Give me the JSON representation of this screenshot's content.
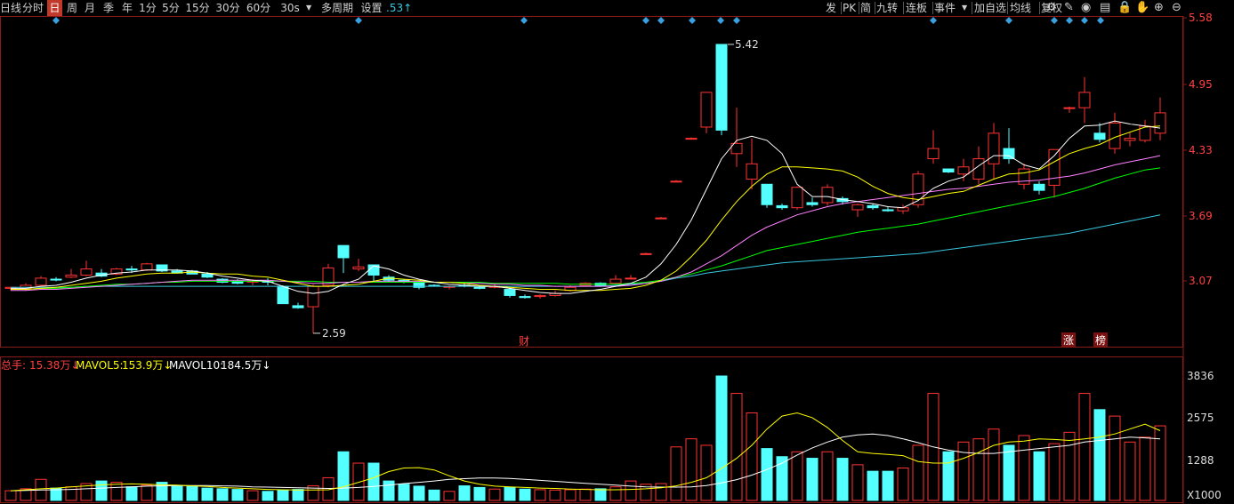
{
  "toolbar": {
    "left": [
      {
        "label": "日线",
        "name": "tab-day-line"
      },
      {
        "label": "分时",
        "name": "tab-timeshare"
      },
      {
        "label": "日",
        "name": "tab-day",
        "active": true
      },
      {
        "label": "周",
        "name": "tab-week"
      },
      {
        "label": "月",
        "name": "tab-month"
      },
      {
        "label": "季",
        "name": "tab-quarter"
      },
      {
        "label": "年",
        "name": "tab-year"
      },
      {
        "label": "1分",
        "name": "tab-1min"
      },
      {
        "label": "5分",
        "name": "tab-5min"
      },
      {
        "label": "15分",
        "name": "tab-15min"
      },
      {
        "label": "30分",
        "name": "tab-30min"
      },
      {
        "label": "60分",
        "name": "tab-60min"
      },
      {
        "label": "30s",
        "name": "tab-30s"
      },
      {
        "label": "多周期",
        "name": "multi-period-button"
      },
      {
        "label": "设置",
        "name": "settings-button"
      },
      {
        "label": ".53↑",
        "name": "price-indicator"
      }
    ],
    "right": [
      {
        "label": "发",
        "name": "publish-button"
      },
      {
        "label": "PK",
        "name": "pk-button"
      },
      {
        "label": "简",
        "name": "simple-button"
      },
      {
        "label": "九转",
        "name": "nine-turn-button"
      },
      {
        "label": "连板",
        "name": "continuous-limit-button"
      },
      {
        "label": "事件",
        "name": "event-button"
      },
      {
        "label": "加自选",
        "name": "add-watchlist-button"
      },
      {
        "label": "均线",
        "name": "moving-average-button"
      },
      {
        "label": "复权",
        "name": "adjust-button"
      }
    ],
    "icons": [
      "settings-icon",
      "draw-icon",
      "eye-icon",
      "save-icon",
      "lock-icon",
      "hand-icon",
      "zoom-in-icon",
      "zoom-out-icon"
    ]
  },
  "price_axis": [
    "5.58",
    "4.95",
    "4.33",
    "3.69",
    "3.07"
  ],
  "volume_axis": [
    "3836",
    "2575",
    "1288",
    "X1000"
  ],
  "annotations": {
    "high": "5.42",
    "low": "2.59",
    "tag_finance": "财",
    "tag_rise": "涨",
    "tag_rank": "榜"
  },
  "volume_legend": {
    "label_total": "总手:",
    "total": "15.38万↓",
    "label_ma5": "MAVOL5:",
    "ma5": "153.9万↓",
    "label_ma10": "MAVOL10:",
    "ma10": "184.5万↓"
  },
  "colors": {
    "up": "#ff3232",
    "down": "#54ffff",
    "ma5": "#ffffff",
    "ma10": "#ffff00",
    "ma20": "#ff80ff",
    "ma30": "#00ff00",
    "ma60": "#38c8e0",
    "accent": "#c0392b"
  },
  "chart_data": {
    "type": "candlestick",
    "ylim": [
      2.45,
      5.62
    ],
    "vol_ylim": [
      0,
      3836
    ],
    "candles": [
      [
        3.03,
        3.04,
        3.01,
        3.04,
        300,
        "u"
      ],
      [
        3.03,
        3.08,
        3.01,
        3.06,
        360,
        "u"
      ],
      [
        3.06,
        3.15,
        3.05,
        3.13,
        650,
        "u"
      ],
      [
        3.12,
        3.14,
        3.1,
        3.12,
        380,
        "d"
      ],
      [
        3.14,
        3.22,
        3.13,
        3.16,
        420,
        "u"
      ],
      [
        3.16,
        3.3,
        3.15,
        3.22,
        520,
        "u"
      ],
      [
        3.18,
        3.22,
        3.14,
        3.15,
        600,
        "d"
      ],
      [
        3.17,
        3.23,
        3.16,
        3.22,
        560,
        "u"
      ],
      [
        3.22,
        3.25,
        3.18,
        3.21,
        420,
        "d"
      ],
      [
        3.21,
        3.28,
        3.2,
        3.27,
        470,
        "u"
      ],
      [
        3.26,
        3.26,
        3.19,
        3.2,
        560,
        "d"
      ],
      [
        3.2,
        3.22,
        3.18,
        3.18,
        450,
        "d"
      ],
      [
        3.2,
        3.21,
        3.17,
        3.17,
        430,
        "d"
      ],
      [
        3.17,
        3.19,
        3.13,
        3.14,
        380,
        "d"
      ],
      [
        3.12,
        3.13,
        3.08,
        3.09,
        360,
        "d"
      ],
      [
        3.1,
        3.12,
        3.07,
        3.08,
        340,
        "d"
      ],
      [
        3.1,
        3.12,
        3.06,
        3.1,
        300,
        "u"
      ],
      [
        3.1,
        3.13,
        3.06,
        3.09,
        280,
        "d"
      ],
      [
        3.05,
        3.06,
        2.88,
        2.88,
        320,
        "d"
      ],
      [
        2.86,
        2.89,
        2.83,
        2.84,
        340,
        "d"
      ],
      [
        2.85,
        3.07,
        2.59,
        3.05,
        450,
        "u"
      ],
      [
        3.06,
        3.27,
        3.04,
        3.23,
        700,
        "u"
      ],
      [
        3.45,
        3.45,
        3.18,
        3.33,
        1500,
        "d"
      ],
      [
        3.22,
        3.32,
        3.2,
        3.24,
        1150,
        "u"
      ],
      [
        3.26,
        3.26,
        3.09,
        3.16,
        1150,
        "d"
      ],
      [
        3.14,
        3.16,
        3.09,
        3.11,
        600,
        "d"
      ],
      [
        3.11,
        3.12,
        3.08,
        3.09,
        500,
        "d"
      ],
      [
        3.09,
        3.1,
        3.02,
        3.04,
        440,
        "d"
      ],
      [
        3.06,
        3.07,
        3.05,
        3.06,
        320,
        "d"
      ],
      [
        3.05,
        3.06,
        3.02,
        3.04,
        280,
        "u"
      ],
      [
        3.06,
        3.08,
        3.04,
        3.06,
        450,
        "d"
      ],
      [
        3.03,
        3.05,
        3.02,
        3.04,
        400,
        "d"
      ],
      [
        3.04,
        3.08,
        3.03,
        3.05,
        350,
        "u"
      ],
      [
        3.02,
        3.04,
        2.94,
        2.96,
        410,
        "d"
      ],
      [
        2.95,
        2.97,
        2.93,
        2.94,
        350,
        "d"
      ],
      [
        2.95,
        2.97,
        2.93,
        2.96,
        330,
        "u"
      ],
      [
        2.96,
        3.01,
        2.95,
        2.98,
        320,
        "u"
      ],
      [
        3.01,
        3.06,
        3.0,
        3.04,
        330,
        "u"
      ],
      [
        3.06,
        3.09,
        3.05,
        3.08,
        350,
        "u"
      ],
      [
        3.08,
        3.09,
        3.05,
        3.06,
        360,
        "d"
      ],
      [
        3.08,
        3.16,
        3.07,
        3.12,
        420,
        "u"
      ],
      [
        3.13,
        3.16,
        3.12,
        3.13,
        600,
        "u"
      ],
      [
        3.37,
        3.38,
        3.36,
        3.37,
        500,
        "u"
      ],
      [
        3.72,
        3.73,
        3.71,
        3.72,
        520,
        "u"
      ],
      [
        4.08,
        4.09,
        4.07,
        4.08,
        1650,
        "u"
      ],
      [
        4.5,
        4.51,
        4.49,
        4.5,
        1900,
        "u"
      ],
      [
        4.61,
        4.95,
        4.55,
        4.95,
        1700,
        "u"
      ],
      [
        5.42,
        5.42,
        4.53,
        4.58,
        3836,
        "d"
      ],
      [
        4.45,
        4.8,
        4.22,
        4.35,
        3300,
        "u"
      ],
      [
        4.25,
        4.5,
        4.0,
        4.1,
        2700,
        "u"
      ],
      [
        4.05,
        4.05,
        3.82,
        3.85,
        1600,
        "d"
      ],
      [
        3.84,
        3.86,
        3.8,
        3.82,
        1350,
        "d"
      ],
      [
        3.82,
        4.03,
        3.8,
        4.02,
        1500,
        "u"
      ],
      [
        3.85,
        3.92,
        3.83,
        3.87,
        1300,
        "d"
      ],
      [
        3.87,
        4.05,
        3.84,
        4.02,
        1500,
        "u"
      ],
      [
        3.91,
        3.93,
        3.85,
        3.88,
        1300,
        "d"
      ],
      [
        3.8,
        3.86,
        3.73,
        3.85,
        1100,
        "u"
      ],
      [
        3.84,
        3.86,
        3.8,
        3.82,
        900,
        "d"
      ],
      [
        3.8,
        3.83,
        3.78,
        3.79,
        900,
        "d"
      ],
      [
        3.79,
        3.85,
        3.76,
        3.82,
        1000,
        "u"
      ],
      [
        3.85,
        4.18,
        3.82,
        4.15,
        1700,
        "u"
      ],
      [
        4.3,
        4.58,
        4.25,
        4.4,
        3300,
        "u"
      ],
      [
        4.2,
        4.2,
        4.16,
        4.17,
        1500,
        "d"
      ],
      [
        4.15,
        4.3,
        4.08,
        4.22,
        1800,
        "u"
      ],
      [
        4.1,
        4.42,
        4.05,
        4.3,
        1900,
        "u"
      ],
      [
        4.25,
        4.65,
        4.1,
        4.55,
        2200,
        "u"
      ],
      [
        4.4,
        4.6,
        4.25,
        4.3,
        1700,
        "d"
      ],
      [
        4.2,
        4.25,
        4.0,
        4.05,
        2000,
        "u"
      ],
      [
        4.05,
        4.08,
        3.95,
        3.99,
        1500,
        "d"
      ],
      [
        4.04,
        4.39,
        3.92,
        4.39,
        1750,
        "u"
      ],
      [
        4.8,
        4.81,
        4.75,
        4.8,
        2100,
        "u"
      ],
      [
        4.8,
        5.1,
        4.65,
        4.95,
        3300,
        "u"
      ],
      [
        4.55,
        4.65,
        4.46,
        4.49,
        2800,
        "d"
      ],
      [
        4.4,
        4.75,
        4.35,
        4.65,
        2600,
        "u"
      ],
      [
        4.48,
        4.56,
        4.42,
        4.5,
        1800,
        "u"
      ],
      [
        4.48,
        4.68,
        4.46,
        4.62,
        1950,
        "u"
      ],
      [
        4.55,
        4.9,
        4.48,
        4.75,
        2300,
        "u"
      ]
    ],
    "ma5": [
      3.03,
      3.03,
      3.05,
      3.06,
      3.09,
      3.13,
      3.16,
      3.18,
      3.19,
      3.21,
      3.21,
      3.21,
      3.2,
      3.18,
      3.15,
      3.13,
      3.11,
      3.1,
      3.05,
      3.0,
      2.98,
      3.0,
      3.07,
      3.12,
      3.25,
      3.22,
      3.16,
      3.12,
      3.09,
      3.07,
      3.06,
      3.05,
      3.05,
      3.03,
      3.01,
      2.99,
      2.98,
      2.98,
      3.0,
      3.02,
      3.05,
      3.08,
      3.14,
      3.27,
      3.46,
      3.7,
      4.0,
      4.3,
      4.48,
      4.52,
      4.48,
      4.35,
      4.05,
      3.93,
      3.93,
      3.9,
      3.88,
      3.86,
      3.83,
      3.82,
      3.89,
      4.01,
      4.08,
      4.12,
      4.23,
      4.33,
      4.33,
      4.24,
      4.2,
      4.33,
      4.5,
      4.62,
      4.63,
      4.67,
      4.64,
      4.62,
      4.6
    ],
    "ma10": [
      3.02,
      3.02,
      3.03,
      3.04,
      3.06,
      3.08,
      3.1,
      3.13,
      3.15,
      3.17,
      3.18,
      3.18,
      3.19,
      3.18,
      3.17,
      3.17,
      3.15,
      3.14,
      3.11,
      3.08,
      3.05,
      3.05,
      3.06,
      3.07,
      3.1,
      3.13,
      3.12,
      3.11,
      3.09,
      3.09,
      3.08,
      3.06,
      3.05,
      3.04,
      3.03,
      3.02,
      3.02,
      3.01,
      3.01,
      3.01,
      3.02,
      3.03,
      3.06,
      3.11,
      3.2,
      3.34,
      3.5,
      3.7,
      3.88,
      4.03,
      4.15,
      4.22,
      4.22,
      4.21,
      4.2,
      4.18,
      4.12,
      4.03,
      3.96,
      3.92,
      3.9,
      3.93,
      3.96,
      3.98,
      4.04,
      4.1,
      4.15,
      4.16,
      4.19,
      4.27,
      4.35,
      4.4,
      4.44,
      4.51,
      4.56,
      4.61,
      4.62
    ],
    "ma20": [
      3.01,
      3.01,
      3.02,
      3.02,
      3.03,
      3.04,
      3.05,
      3.06,
      3.07,
      3.08,
      3.09,
      3.1,
      3.11,
      3.11,
      3.11,
      3.11,
      3.11,
      3.11,
      3.1,
      3.09,
      3.08,
      3.08,
      3.09,
      3.09,
      3.1,
      3.1,
      3.1,
      3.1,
      3.09,
      3.09,
      3.08,
      3.08,
      3.07,
      3.07,
      3.06,
      3.06,
      3.05,
      3.05,
      3.05,
      3.05,
      3.05,
      3.06,
      3.08,
      3.1,
      3.14,
      3.19,
      3.27,
      3.35,
      3.45,
      3.55,
      3.63,
      3.69,
      3.75,
      3.79,
      3.83,
      3.86,
      3.88,
      3.9,
      3.92,
      3.94,
      3.96,
      3.98,
      4.0,
      4.01,
      4.03,
      4.05,
      4.07,
      4.08,
      4.09,
      4.11,
      4.13,
      4.16,
      4.2,
      4.24,
      4.27,
      4.3,
      4.33
    ],
    "ma30": [
      3.02,
      3.02,
      3.03,
      3.03,
      3.04,
      3.05,
      3.06,
      3.07,
      3.07,
      3.08,
      3.09,
      3.09,
      3.1,
      3.1,
      3.1,
      3.1,
      3.1,
      3.1,
      3.1,
      3.1,
      3.1,
      3.09,
      3.09,
      3.09,
      3.09,
      3.09,
      3.09,
      3.09,
      3.09,
      3.09,
      3.09,
      3.09,
      3.08,
      3.08,
      3.08,
      3.08,
      3.08,
      3.07,
      3.07,
      3.07,
      3.07,
      3.08,
      3.09,
      3.11,
      3.14,
      3.17,
      3.21,
      3.25,
      3.3,
      3.35,
      3.4,
      3.43,
      3.46,
      3.49,
      3.52,
      3.55,
      3.58,
      3.6,
      3.62,
      3.64,
      3.66,
      3.69,
      3.72,
      3.75,
      3.78,
      3.81,
      3.84,
      3.87,
      3.9,
      3.93,
      3.97,
      4.01,
      4.06,
      4.11,
      4.15,
      4.19,
      4.21
    ],
    "ma60": [
      3.04,
      3.04,
      3.04,
      3.04,
      3.04,
      3.05,
      3.05,
      3.05,
      3.05,
      3.05,
      3.05,
      3.05,
      3.05,
      3.05,
      3.05,
      3.05,
      3.05,
      3.05,
      3.05,
      3.05,
      3.05,
      3.05,
      3.05,
      3.05,
      3.05,
      3.05,
      3.05,
      3.05,
      3.05,
      3.05,
      3.05,
      3.05,
      3.05,
      3.05,
      3.05,
      3.05,
      3.05,
      3.05,
      3.05,
      3.05,
      3.06,
      3.07,
      3.08,
      3.1,
      3.13,
      3.15,
      3.18,
      3.2,
      3.22,
      3.24,
      3.26,
      3.28,
      3.29,
      3.3,
      3.31,
      3.32,
      3.33,
      3.34,
      3.35,
      3.36,
      3.37,
      3.39,
      3.41,
      3.43,
      3.45,
      3.47,
      3.49,
      3.51,
      3.53,
      3.55,
      3.57,
      3.6,
      3.63,
      3.66,
      3.69,
      3.72,
      3.75
    ],
    "vol_ma5": [
      300,
      330,
      360,
      380,
      420,
      450,
      480,
      500,
      510,
      500,
      480,
      470,
      450,
      430,
      400,
      380,
      360,
      340,
      330,
      320,
      320,
      330,
      420,
      560,
      700,
      890,
      1000,
      1010,
      940,
      760,
      600,
      500,
      440,
      420,
      400,
      380,
      370,
      350,
      340,
      330,
      330,
      340,
      360,
      390,
      450,
      560,
      700,
      990,
      1300,
      1700,
      2200,
      2600,
      2700,
      2550,
      2250,
      1850,
      1500,
      1450,
      1420,
      1380,
      1200,
      1150,
      1150,
      1300,
      1480,
      1700,
      1800,
      1830,
      1900,
      1880,
      1850,
      1900,
      1950,
      2050,
      2200,
      2350,
      2150
    ],
    "vol_ma10": [
      300,
      310,
      320,
      330,
      340,
      360,
      380,
      400,
      420,
      440,
      450,
      460,
      460,
      460,
      450,
      440,
      420,
      410,
      400,
      390,
      380,
      370,
      380,
      400,
      430,
      470,
      520,
      560,
      600,
      650,
      670,
      690,
      690,
      680,
      650,
      620,
      590,
      560,
      530,
      500,
      470,
      440,
      420,
      410,
      410,
      420,
      460,
      540,
      640,
      780,
      950,
      1150,
      1400,
      1620,
      1800,
      1950,
      2020,
      2050,
      2000,
      1900,
      1780,
      1650,
      1550,
      1480,
      1450,
      1450,
      1500,
      1550,
      1600,
      1650,
      1700,
      1800,
      1850,
      1900,
      1950,
      1930,
      1900
    ]
  }
}
